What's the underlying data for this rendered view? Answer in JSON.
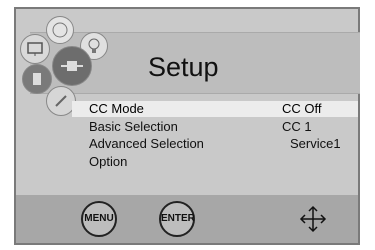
{
  "header": {
    "title": "Setup"
  },
  "menu": {
    "items": [
      {
        "label": "CC Mode",
        "value": "CC Off",
        "selected": true
      },
      {
        "label": "Basic Selection",
        "value": "CC 1",
        "selected": false
      },
      {
        "label": "Advanced Selection",
        "value": "Service1",
        "selected": false
      },
      {
        "label": "Option",
        "value": "",
        "selected": false
      }
    ]
  },
  "buttons": {
    "menu_label": "MENU",
    "enter_label": "ENTER"
  },
  "icons": [
    "tv-icon",
    "globe-icon",
    "bulb-icon",
    "satellite-icon",
    "speaker-icon",
    "tools-icon",
    "move-arrows-icon"
  ]
}
